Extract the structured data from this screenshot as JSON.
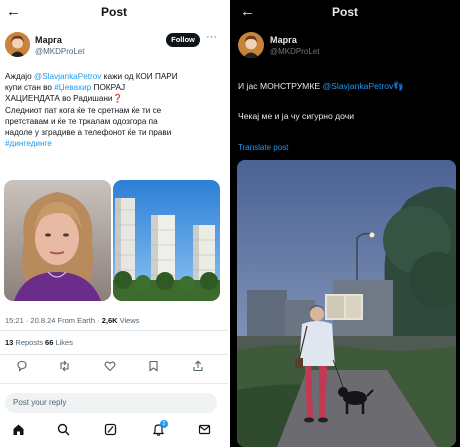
{
  "left": {
    "back_icon": "←",
    "title": "Post",
    "author": {
      "name": "Марга",
      "handle": "@MKDProLet"
    },
    "follow_label": "Follow",
    "more_icon": "···",
    "tweet_lines": [
      {
        "a": "Аждајо ",
        "mention": "@SlavjankaPetrov",
        "b": " кажи од КОИ ПАРИ"
      },
      {
        "a": "купи стан во ",
        "hashtag": "#Џевахир",
        "b": " ПОКРАЈ"
      },
      {
        "a": "ХАЦИЕНДАТА во Радишани",
        "mark": "❓"
      },
      {
        "a": "Следниот пат кога ќе те сретнам ќе ти се"
      },
      {
        "a": "претставам и ќе те тркалам одозгора па"
      },
      {
        "a": "надоле у зградиве а телефонот ќе ти прави"
      },
      {
        "hashtag": "#дингединге"
      }
    ],
    "meta": {
      "time": "15:21 · 20.8.24 From Earth · ",
      "views_count": "2,6K",
      "views_label": " Views"
    },
    "stats": {
      "reposts_count": "13",
      "reposts_label": " Reposts  ",
      "likes_count": "66",
      "likes_label": " Likes"
    },
    "reply_placeholder": "Post your reply",
    "notif_badge": "2"
  },
  "right": {
    "back_icon": "←",
    "title": "Post",
    "author": {
      "name": "Марга",
      "handle": "@MKDProLet"
    },
    "line1_a": "И јас МОНСТРУМКЕ ",
    "line1_mention": "@SlavjankaPetrov",
    "line1_emoji": "👣",
    "line2": "Чекај ме и ја чу сигурно дочи",
    "translate": "Translate post"
  },
  "colors": {
    "accent": "#1d9bf0",
    "dark_bg": "#000000",
    "light_bg": "#ffffff"
  }
}
